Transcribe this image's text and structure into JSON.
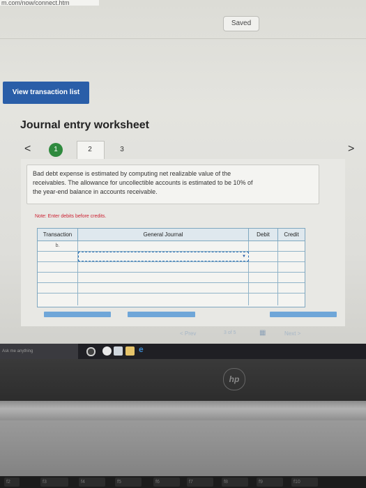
{
  "browser": {
    "url_fragment": "m.com/now/connect.htm"
  },
  "header": {
    "saved_label": "Saved"
  },
  "view_transaction_button": "View transaction list",
  "worksheet": {
    "title": "Journal entry worksheet",
    "steps": [
      "1",
      "2",
      "3"
    ],
    "description_line1": "Bad debt expense is estimated by computing net realizable value of the",
    "description_line2": "receivables. The allowance for uncollectible accounts is estimated to be 10% of",
    "description_line3": "the year-end balance in accounts receivable.",
    "note": "Note: Enter debits before credits.",
    "table": {
      "headers": [
        "Transaction",
        "General Journal",
        "Debit",
        "Credit"
      ],
      "first_transaction": "b."
    }
  },
  "pager": {
    "prev": "< Prev",
    "count": "3 of 5",
    "next": "Next >"
  },
  "taskbar": {
    "search_placeholder": "Ask me anything"
  },
  "laptop": {
    "brand": "hp"
  },
  "fkeys": [
    "f2",
    "f3",
    "f4",
    "f5",
    "f6",
    "f7",
    "f8",
    "f9",
    "f10"
  ],
  "colors": {
    "accent": "#2a5ea8",
    "step_active": "#2f8a3e",
    "table_border": "#7fa7bf"
  }
}
